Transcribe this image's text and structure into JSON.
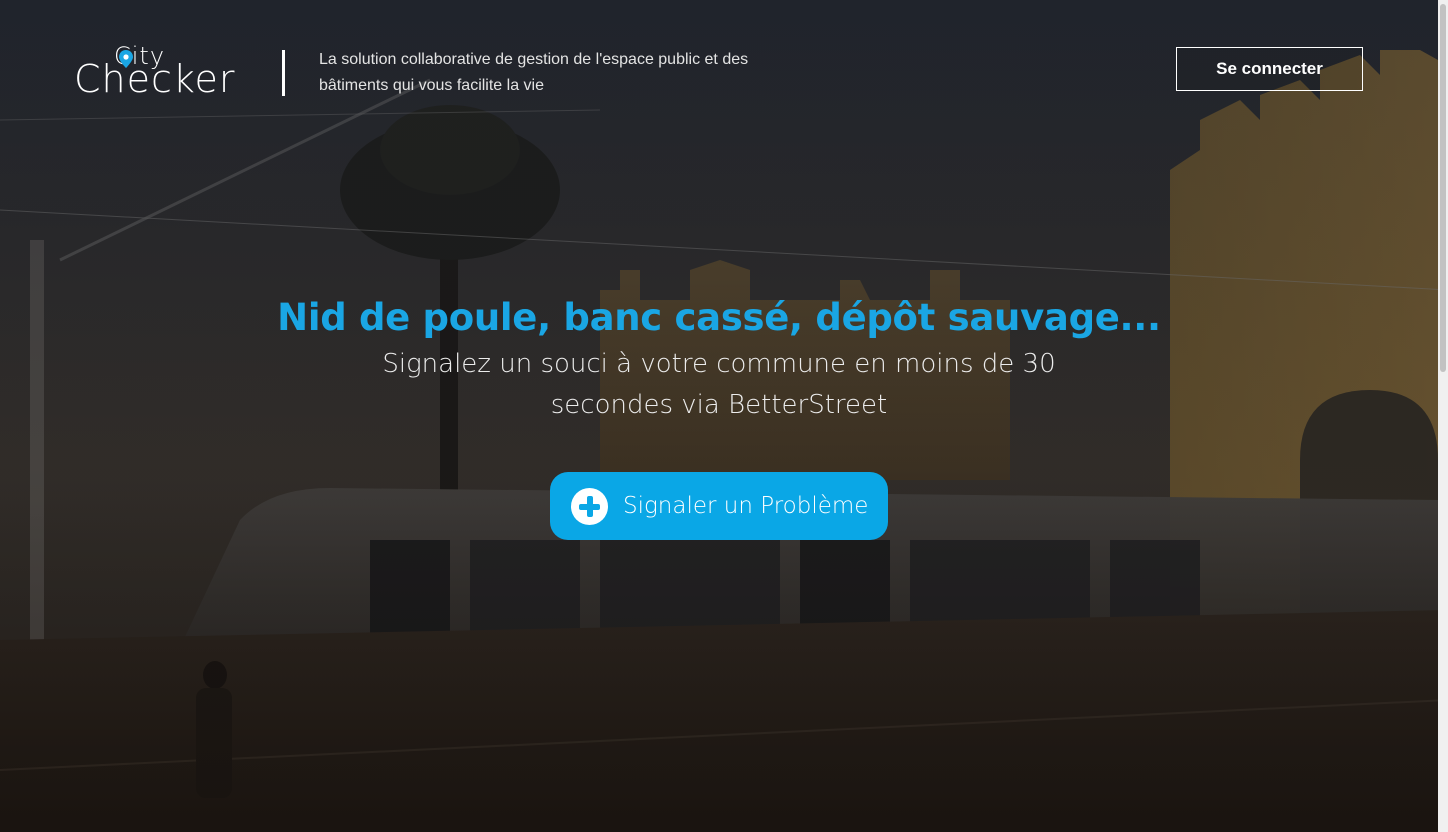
{
  "header": {
    "logo_top": "City",
    "logo_bottom": "Checker",
    "tagline": "La solution collaborative de gestion de l'espace public et des bâtiments qui vous facilite la vie",
    "login_label": "Se connecter"
  },
  "hero": {
    "title": "Nid de poule, banc cassé, dépôt sauvage...",
    "subtitle": "Signalez un souci à votre commune en moins de 30 secondes via BetterStreet",
    "cta_label": "Signaler un Problème",
    "cta_icon": "plus-circle-icon"
  },
  "colors": {
    "accent": "#1aa6e4",
    "button": "#0aa7e6",
    "text": "#ffffff"
  }
}
